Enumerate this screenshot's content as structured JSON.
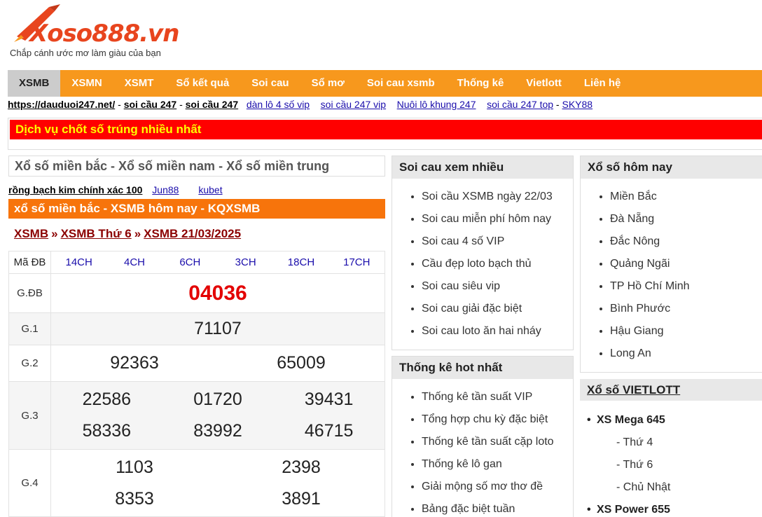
{
  "header": {
    "logo_text": "Xoso888.vn",
    "tagline": "Chắp cánh ước mơ làm giàu của bạn"
  },
  "nav": [
    {
      "label": "XSMB",
      "active": true
    },
    {
      "label": "XSMN"
    },
    {
      "label": "XSMT"
    },
    {
      "label": "Sổ kết quả"
    },
    {
      "label": "Soi cau"
    },
    {
      "label": "Sổ mơ"
    },
    {
      "label": "Soi cau xsmb"
    },
    {
      "label": "Thống kê"
    },
    {
      "label": "Vietlott"
    },
    {
      "label": "Liên hệ"
    }
  ],
  "links_bar": {
    "l1": "https://dauduoi247.net/",
    "sep1": " - ",
    "l2": "soi cầu 247",
    "sep2": " - ",
    "l3": "soi cầu 247",
    "l4": "dàn lô 4 số vip",
    "l5": "soi cầu 247 vip",
    "l6": "Nuôi lô khung 247",
    "l7": "soi cầu 247 top",
    "sep3": " - ",
    "l8": "SKY88"
  },
  "banner": "Dịch vụ chốt số trúng nhiều nhất",
  "region_title": "Xổ số miền bắc - Xổ số miền nam - Xổ số miền trung",
  "sublinks": {
    "a": "rồng bạch kim chính xác 100",
    "b": "Jun88",
    "c": "kubet"
  },
  "results_heading": "xổ số miền bắc - XSMB hôm nay - KQXSMB",
  "breadcrumb": {
    "c1": "XSMB",
    "c2": "XSMB Thứ 6",
    "c3": "XSMB 21/03/2025",
    "arrow": "»"
  },
  "table": {
    "header_label": "Mã ĐB",
    "codes": [
      "14CH",
      "4CH",
      "6CH",
      "3CH",
      "18CH",
      "17CH"
    ],
    "db": {
      "label": "G.ĐB",
      "value": "04036"
    },
    "g1": {
      "label": "G.1",
      "value": "71107"
    },
    "g2": {
      "label": "G.2",
      "values": [
        "92363",
        "65009"
      ]
    },
    "g3": {
      "label": "G.3",
      "values": [
        "22586",
        "01720",
        "39431",
        "58336",
        "83992",
        "46715"
      ]
    },
    "g4": {
      "label": "G.4",
      "values": [
        "1103",
        "2398",
        "8353",
        "3891"
      ]
    }
  },
  "soicau_box": {
    "title": "Soi cau xem nhiều",
    "items": [
      "Soi cầu XSMB ngày 22/03",
      "Soi cau miễn phí hôm nay",
      "Soi cau 4 số VIP",
      "Cầu đẹp loto bạch thủ",
      "Soi cau siêu vip",
      "Soi cau giải đặc biệt",
      "Soi cau loto ăn hai nháy"
    ]
  },
  "thongke_box": {
    "title": "Thống kê hot nhất",
    "items": [
      "Thống kê tần suất VIP",
      "Tổng hợp chu kỳ đặc biệt",
      "Thống kê tần suất cặp loto",
      "Thống kê lô gan",
      "Giải mộng số mơ thơ đề",
      "Bảng đặc biệt tuần"
    ]
  },
  "homnay_box": {
    "title": "Xổ số hôm nay",
    "items": [
      "Miền Bắc",
      "Đà Nẵng",
      "Đắc Nông",
      "Quảng Ngãi",
      "TP Hồ Chí Minh",
      "Bình Phước",
      "Hậu Giang",
      "Long An"
    ]
  },
  "vietlott": {
    "title": "Xổ số VIETLOTT",
    "game1": "XS Mega 645",
    "days": [
      "- Thứ 4",
      "- Thứ 6",
      "- Chủ Nhật"
    ],
    "game2": "XS Power 655"
  },
  "colors": {
    "nav_bg": "#f7981d",
    "heading_orange": "#f7740b",
    "banner_red": "#ff0000",
    "banner_text": "#ffff00",
    "special_prize": "#e30000"
  }
}
